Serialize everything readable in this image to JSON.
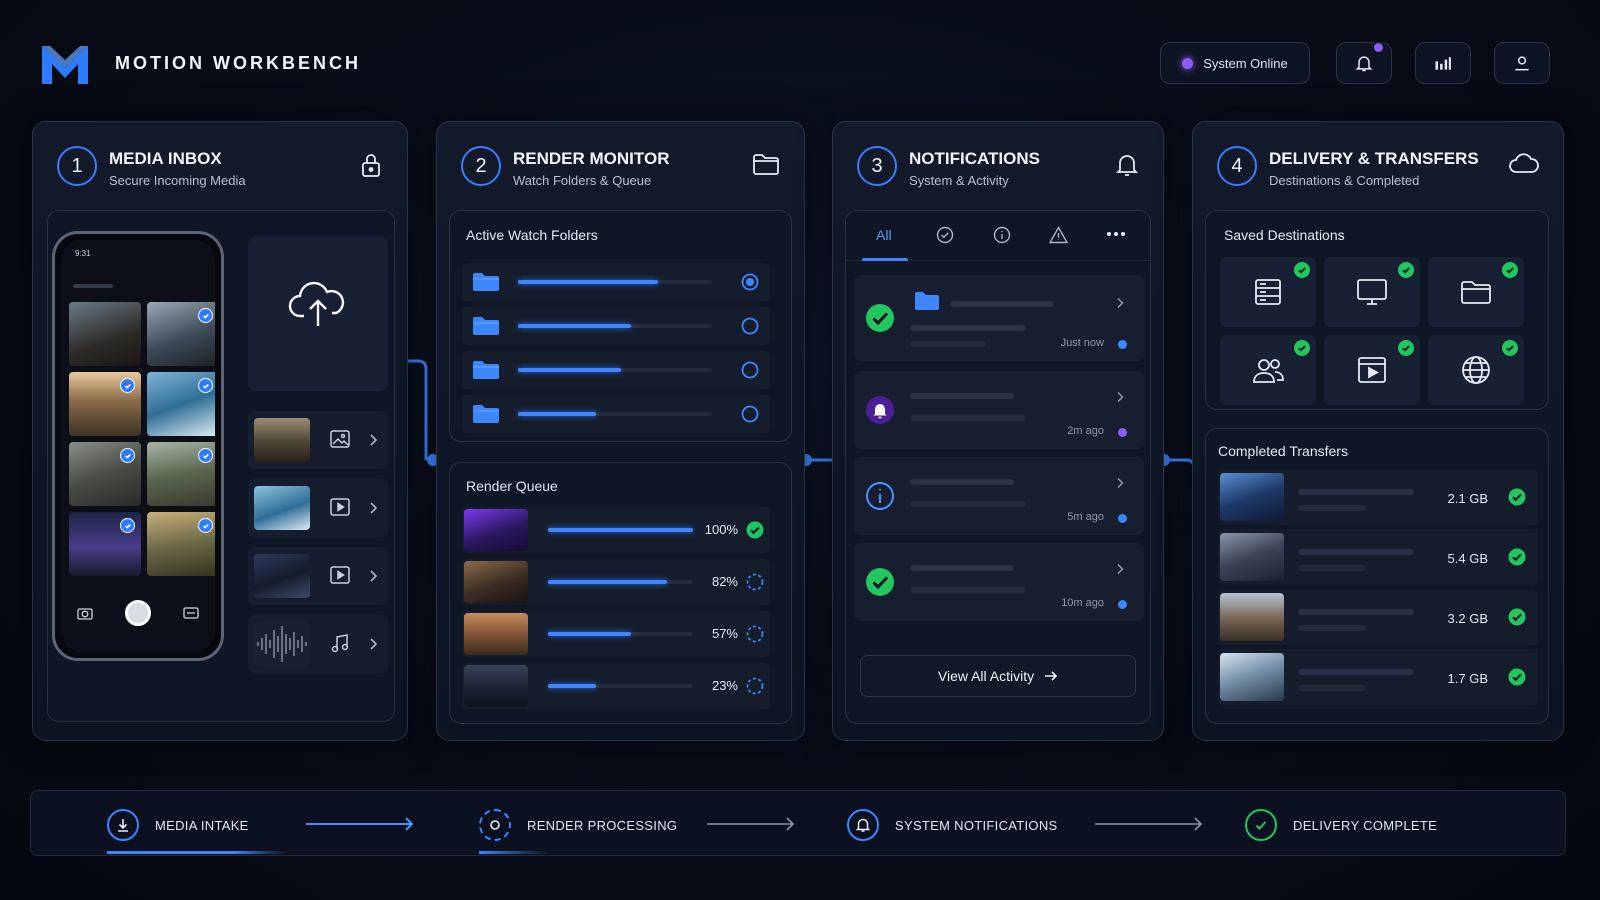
{
  "app": {
    "title": "MOTION WORKBENCH",
    "status": "System Online",
    "accent": "#3d86ff",
    "status_color": "#8b5cf6",
    "success_color": "#22c55e"
  },
  "panels": {
    "inbox": {
      "number": "1",
      "title": "MEDIA INBOX",
      "subtitle": "Secure Incoming Media",
      "phone_time": "9:31"
    },
    "render": {
      "number": "2",
      "title": "RENDER MONITOR",
      "subtitle": "Watch Folders & Queue",
      "watch_label": "Active Watch Folders",
      "watch_folders": [
        {
          "progress": 0.72,
          "selected": true
        },
        {
          "progress": 0.58,
          "selected": false
        },
        {
          "progress": 0.53,
          "selected": false
        },
        {
          "progress": 0.4,
          "selected": false
        }
      ],
      "queue_label": "Render Queue",
      "queue": [
        {
          "pct": "100%",
          "progress": 1.0,
          "done": true
        },
        {
          "pct": "82%",
          "progress": 0.82,
          "done": false
        },
        {
          "pct": "57%",
          "progress": 0.57,
          "done": false
        },
        {
          "pct": "23%",
          "progress": 0.33,
          "done": false
        }
      ]
    },
    "notifications": {
      "number": "3",
      "title": "NOTIFICATIONS",
      "subtitle": "System & Activity",
      "tabs": [
        "All"
      ],
      "items": [
        {
          "time": "Just now",
          "icon": "check-circle-icon",
          "dot": "#3d86ff"
        },
        {
          "time": "2m ago",
          "icon": "bell-icon",
          "dot": "#8b5cf6"
        },
        {
          "time": "5m ago",
          "icon": "info-icon",
          "dot": "#3d86ff"
        },
        {
          "time": "10m ago",
          "icon": "check-circle-icon",
          "dot": "#3d86ff"
        }
      ],
      "view_all": "View All Activity"
    },
    "delivery": {
      "number": "4",
      "title": "DELIVERY & TRANSFERS",
      "subtitle": "Destinations & Completed",
      "saved_label": "Saved Destinations",
      "destinations": [
        "server-icon",
        "monitor-icon",
        "folder-icon",
        "users-icon",
        "video-icon",
        "globe-icon"
      ],
      "completed_label": "Completed Transfers",
      "transfers": [
        {
          "size": "2.1 GB"
        },
        {
          "size": "5.4 GB"
        },
        {
          "size": "3.2 GB"
        },
        {
          "size": "1.7 GB"
        }
      ]
    }
  },
  "footer": {
    "steps": [
      "MEDIA INTAKE",
      "RENDER PROCESSING",
      "SYSTEM NOTIFICATIONS",
      "DELIVERY COMPLETE"
    ]
  }
}
